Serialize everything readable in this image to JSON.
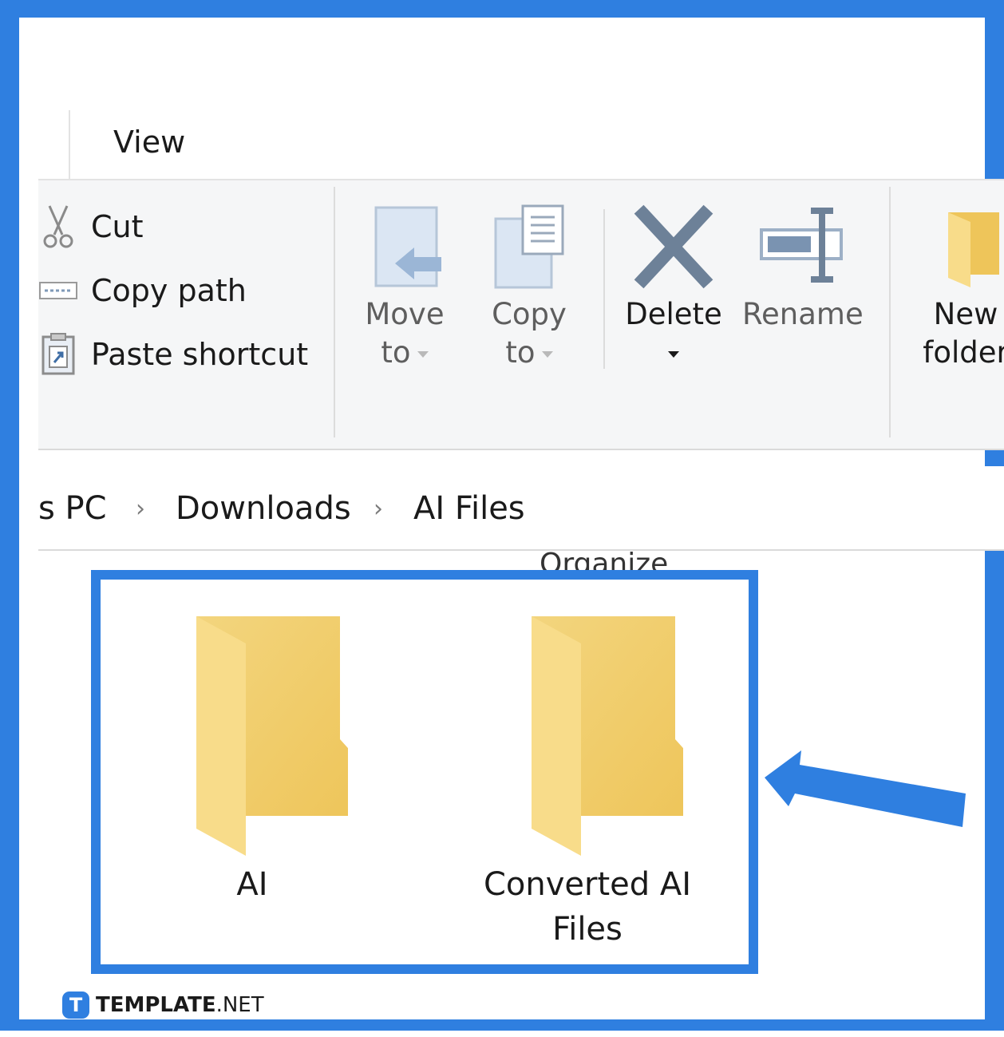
{
  "ribbon": {
    "tab_view": "View",
    "clipboard": {
      "cut": "Cut",
      "copy_path": "Copy path",
      "paste_shortcut": "Paste shortcut"
    },
    "organize": {
      "move_to": [
        "Move",
        "to"
      ],
      "copy_to": [
        "Copy",
        "to"
      ],
      "delete": "Delete",
      "rename": "Rename",
      "group_label": "Organize"
    },
    "new": {
      "new_folder": [
        "New",
        "folder"
      ]
    }
  },
  "breadcrumb": {
    "items": [
      "s PC",
      "Downloads",
      "AI Files"
    ]
  },
  "folders": [
    {
      "name": "AI"
    },
    {
      "name_lines": [
        "Converted AI",
        "Files"
      ]
    }
  ],
  "watermark": {
    "badge": "T",
    "brand_bold": "TEMPLATE",
    "brand_rest": ".NET"
  },
  "colors": {
    "accent": "#2f7fe0",
    "folder_light": "#f8dc8a",
    "folder_dark": "#eec55a"
  }
}
